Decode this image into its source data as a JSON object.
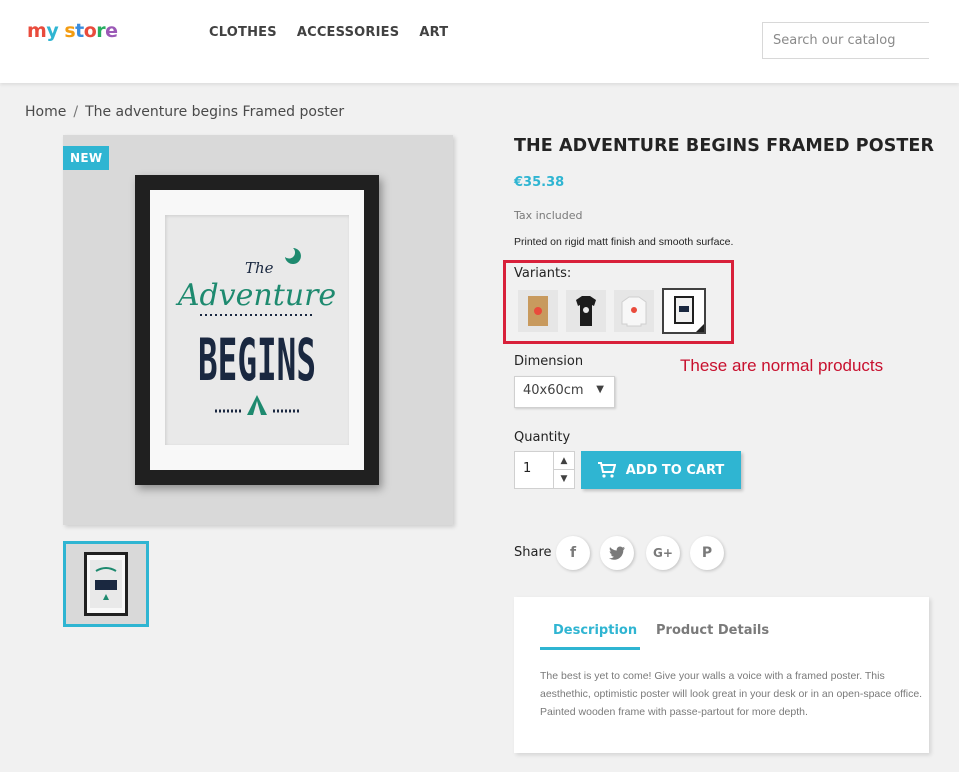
{
  "header": {
    "logo_letters": [
      {
        "char": "m",
        "color": "#e94b3c"
      },
      {
        "char": "y",
        "color": "#2fb5d2"
      },
      {
        "char": " ",
        "color": "#232323"
      },
      {
        "char": "s",
        "color": "#f39c12"
      },
      {
        "char": "t",
        "color": "#3a8dde"
      },
      {
        "char": "o",
        "color": "#e94b3c"
      },
      {
        "char": "r",
        "color": "#27ae60"
      },
      {
        "char": "e",
        "color": "#9b59b6"
      }
    ],
    "nav": [
      "CLOTHES",
      "ACCESSORIES",
      "ART"
    ],
    "search_placeholder": "Search our catalog"
  },
  "breadcrumb": {
    "home": "Home",
    "separator": "/",
    "current": "The adventure begins Framed poster"
  },
  "product": {
    "badge": "NEW",
    "poster": {
      "line1": "The",
      "line2": "Adventure",
      "line3": "BEGINS"
    },
    "title": "THE ADVENTURE BEGINS FRAMED POSTER",
    "price": "€35.38",
    "tax": "Tax included",
    "short_description": "Printed on rigid matt finish and smooth surface.",
    "variants_label": "Variants:",
    "annotation": "These are normal products",
    "dimension_label": "Dimension",
    "dimension_value": "40x60cm",
    "quantity_label": "Quantity",
    "quantity_value": "1",
    "add_to_cart": "ADD TO CART",
    "share_label": "Share",
    "share_icons": {
      "facebook": "f",
      "twitter": "t",
      "googleplus": "G+",
      "pinterest": "P"
    }
  },
  "tabs": {
    "description": "Description",
    "details": "Product Details",
    "content": "The best is yet to come! Give your walls a voice with a framed poster. This aesthethic, optimistic poster will look great in your desk or in an open-space office. Painted wooden frame with passe-partout for more depth."
  },
  "colors": {
    "accent": "#2fb5d2",
    "annotation": "#c8102e"
  }
}
